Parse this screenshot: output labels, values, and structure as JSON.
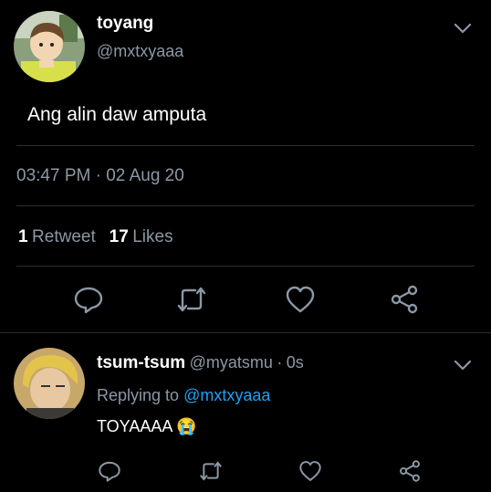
{
  "tweet": {
    "display_name": "toyang",
    "handle": "@mxtxyaaa",
    "text": "Ang alin daw amputa",
    "time": "03:47 PM",
    "separator": "·",
    "date": "02 Aug 20",
    "retweets_count": "1",
    "retweets_label": "Retweet",
    "likes_count": "17",
    "likes_label": "Likes"
  },
  "reply": {
    "display_name": "tsum-tsum",
    "handle": "@myatsmu",
    "separator": "·",
    "age": "0s",
    "replying_prefix": "Replying to",
    "replying_handle": "@mxtxyaaa",
    "text": "TOYAAAA",
    "emoji": "😭"
  },
  "colors": {
    "background": "#000000",
    "secondary_text": "#8b98a5",
    "link": "#1da1f2",
    "divider": "#2b2f33"
  },
  "icons": {
    "actions": [
      "reply-icon",
      "retweet-icon",
      "like-icon",
      "share-icon"
    ],
    "menu": "chevron-down-icon"
  }
}
